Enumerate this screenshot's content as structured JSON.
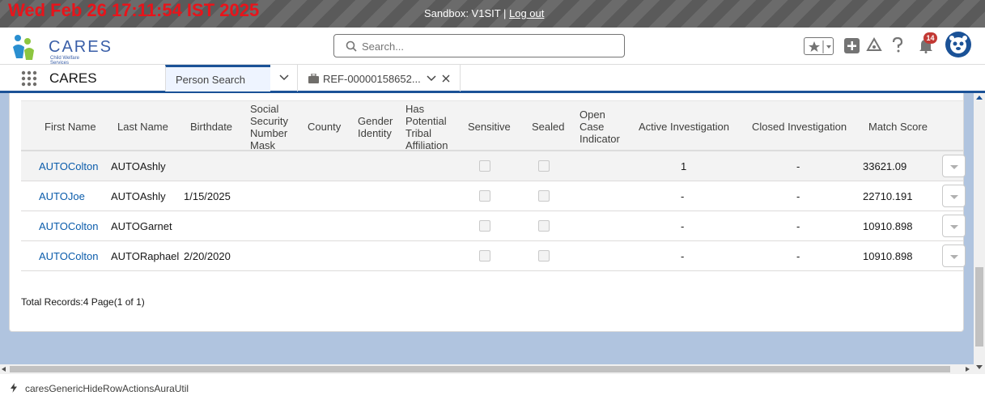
{
  "clock": "Wed Feb 26 17:11:54 IST 2025",
  "sandbox": {
    "label": "Sandbox: V1SIT |",
    "logout": "Log out"
  },
  "header": {
    "logo_text": "CARES",
    "logo_sub": "Child Welfare Services",
    "search_placeholder": "Search...",
    "notification_count": "14",
    "brand_color": "#1b5297"
  },
  "nav": {
    "app_name": "CARES",
    "tabs": [
      {
        "label": "Person Search"
      },
      {
        "label": "REF-00000158652..."
      }
    ]
  },
  "table": {
    "headers": {
      "first_name": "First Name",
      "last_name": "Last Name",
      "birthdate": "Birthdate",
      "ssn_mask": [
        "Social",
        "Security",
        "Number",
        "Mask"
      ],
      "county": "County",
      "gender": [
        "Gender",
        "Identity"
      ],
      "tribal": [
        "Has",
        "Potential",
        "Tribal",
        "Affiliation"
      ],
      "sensitive": "Sensitive",
      "sealed": "Sealed",
      "open_case": [
        "Open",
        "Case",
        "Indicator"
      ],
      "active_inv": "Active Investigation",
      "closed_inv": "Closed Investigation",
      "match_score": "Match Score"
    },
    "rows": [
      {
        "first_name": "AUTOColton",
        "last_name": "AUTOAshly",
        "birthdate": "",
        "active_inv": "1",
        "closed_inv": "-",
        "match_score": "33621.09"
      },
      {
        "first_name": "AUTOJoe",
        "last_name": "AUTOAshly",
        "birthdate": "1/15/2025",
        "active_inv": "-",
        "closed_inv": "-",
        "match_score": "22710.191"
      },
      {
        "first_name": "AUTOColton",
        "last_name": "AUTOGarnet",
        "birthdate": "",
        "active_inv": "-",
        "closed_inv": "-",
        "match_score": "10910.898"
      },
      {
        "first_name": "AUTOColton",
        "last_name": "AUTORaphael",
        "birthdate": "2/20/2020",
        "active_inv": "-",
        "closed_inv": "-",
        "match_score": "10910.898"
      }
    ],
    "total": "Total Records:4 Page(1 of 1)"
  },
  "status_bar": {
    "text": "caresGenericHideRowActionsAuraUtil"
  }
}
